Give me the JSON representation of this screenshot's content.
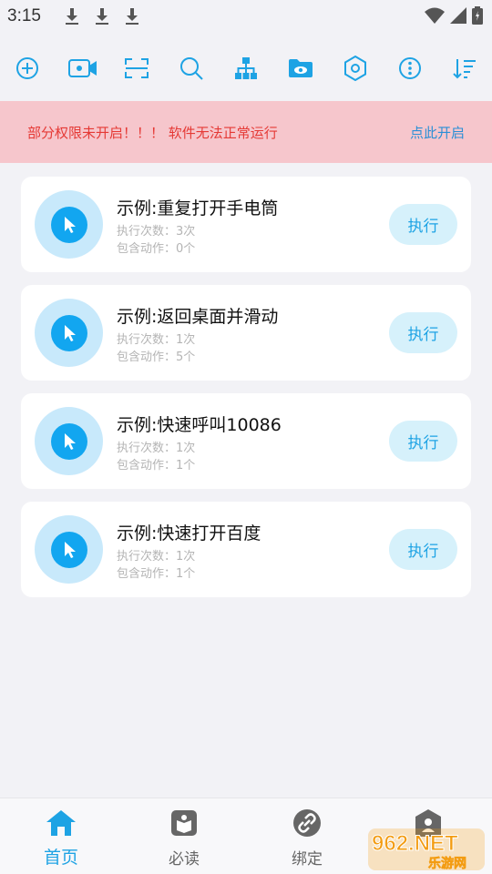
{
  "status_bar": {
    "time": "3:15"
  },
  "toolbar": {
    "icons": [
      "add-icon",
      "video-record-icon",
      "scan-icon",
      "search-icon",
      "hierarchy-icon",
      "folder-view-icon",
      "hexagon-settings-icon",
      "more-options-icon",
      "sort-icon"
    ]
  },
  "banner": {
    "message": "部分权限未开启！！！ 软件无法正常运行",
    "action": "点此开启"
  },
  "tasks": [
    {
      "title": "示例:重复打开手电筒",
      "runs": "执行次数：3次",
      "actions": "包含动作：0个",
      "button": "执行"
    },
    {
      "title": "示例:返回桌面并滑动",
      "runs": "执行次数：1次",
      "actions": "包含动作：5个",
      "button": "执行"
    },
    {
      "title": "示例:快速呼叫10086",
      "runs": "执行次数：1次",
      "actions": "包含动作：1个",
      "button": "执行"
    },
    {
      "title": "示例:快速打开百度",
      "runs": "执行次数：1次",
      "actions": "包含动作：1个",
      "button": "执行"
    }
  ],
  "bottom_nav": {
    "items": [
      {
        "label": "首页",
        "active": true
      },
      {
        "label": "必读",
        "active": false
      },
      {
        "label": "绑定",
        "active": false
      },
      {
        "label": "",
        "active": false
      }
    ]
  },
  "watermark": {
    "brand": "962.NET",
    "site": "乐游网"
  },
  "colors": {
    "accent": "#1ea3e4",
    "banner_bg": "#f6c6cc",
    "warning_text": "#e53935"
  }
}
